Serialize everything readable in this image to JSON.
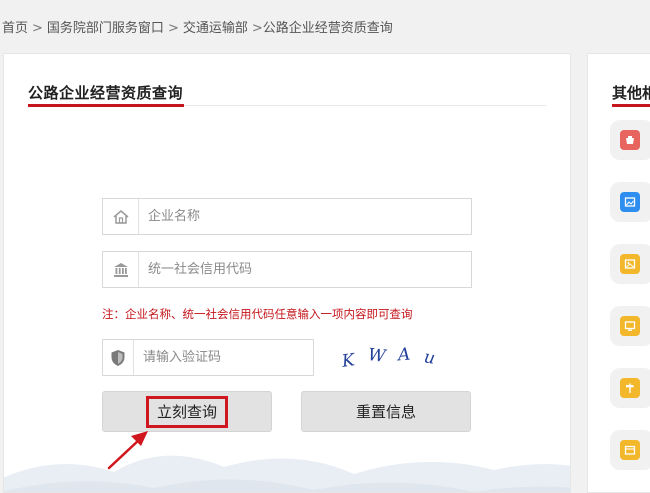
{
  "breadcrumb": {
    "items": [
      "首页",
      "国务院部门服务窗口",
      "交通运输部",
      "公路企业经营资质查询"
    ],
    "separator": ">"
  },
  "card": {
    "title": "公路企业经营资质查询"
  },
  "form": {
    "company_name_placeholder": "企业名称",
    "credit_code_placeholder": "统一社会信用代码",
    "note": "注：企业名称、统一社会信用代码任意输入一项内容即可查询",
    "captcha_placeholder": "请输入验证码",
    "captcha_chars": [
      "K",
      "W",
      "A",
      "u"
    ]
  },
  "buttons": {
    "query_label": "立刻查询",
    "reset_label": "重置信息"
  },
  "side": {
    "title": "其他相",
    "items": [
      {
        "icon": "red-app-icon",
        "color": "#e8645f"
      },
      {
        "icon": "blue-image-icon",
        "color": "#2e8ef0"
      },
      {
        "icon": "yellow-image-icon",
        "color": "#f3b72b"
      },
      {
        "icon": "yellow-screen-icon",
        "color": "#f3b72b"
      },
      {
        "icon": "yellow-signpost-icon",
        "color": "#f3b72b"
      },
      {
        "icon": "yellow-box-icon",
        "color": "#f3b72b"
      }
    ]
  },
  "colors": {
    "accent_red": "#c4161c",
    "captcha_blue": "#23409a"
  }
}
